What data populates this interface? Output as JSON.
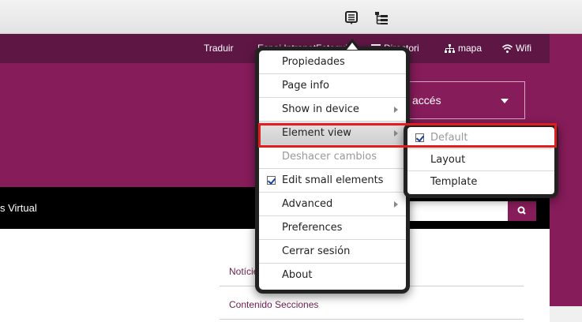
{
  "toolbar": {
    "icons": [
      "context-menu-icon",
      "element-tree-icon"
    ]
  },
  "utility_bar": {
    "links": [
      {
        "label": "Traduir"
      },
      {
        "label": "Espai Intranet"
      },
      {
        "label": "Fotoguia"
      },
      {
        "label": "Directori",
        "icon": "list-icon"
      },
      {
        "label": "mapa",
        "icon": "sitemap-icon"
      },
      {
        "label": "Wifi",
        "icon": "wifi-icon"
      }
    ]
  },
  "header": {
    "access_label": "accés"
  },
  "navbar": {
    "text": "s Virtual"
  },
  "content_list": {
    "items": [
      "Notícies",
      "Contenido Secciones"
    ]
  },
  "context_menu": {
    "items": [
      {
        "label": "Propiedades"
      },
      {
        "label": "Page info"
      },
      {
        "label": "Show in device",
        "submenu": true
      },
      {
        "label": "Element view",
        "submenu": true,
        "state": "hover"
      },
      {
        "label": "Deshacer cambios",
        "state": "disabled"
      },
      {
        "label": "Edit small elements",
        "checked": true
      },
      {
        "label": "Advanced",
        "submenu": true
      },
      {
        "label": "Preferences"
      },
      {
        "label": "Cerrar sesión"
      },
      {
        "label": "About"
      }
    ]
  },
  "element_view_submenu": {
    "items": [
      {
        "label": "Default",
        "checked": true,
        "state": "disabled"
      },
      {
        "label": "Layout"
      },
      {
        "label": "Template"
      }
    ]
  },
  "colors": {
    "utility_bar": "#5e1744",
    "brand_purple": "#871c5a",
    "highlight_red": "#e11d1d"
  }
}
